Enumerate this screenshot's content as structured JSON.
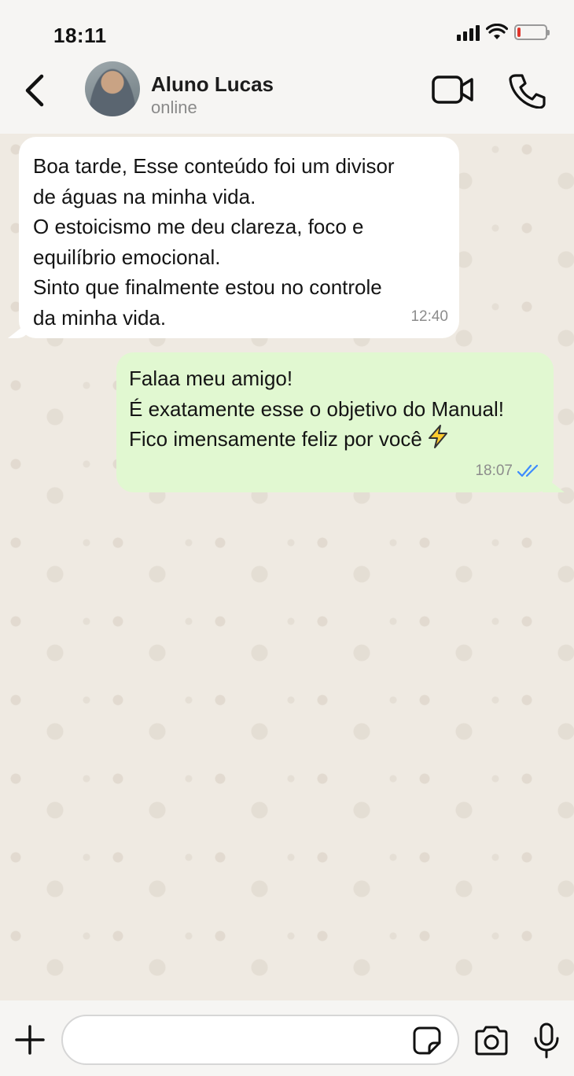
{
  "status_bar": {
    "time": "18:11",
    "battery_level": 0.12,
    "battery_color": "#e0352b"
  },
  "header": {
    "back_icon": "chevron-left-icon",
    "contact_name": "Aluno Lucas",
    "contact_status": "online",
    "video_icon": "video-camera-icon",
    "call_icon": "phone-icon"
  },
  "messages": [
    {
      "direction": "incoming",
      "lines": [
        "Boa tarde, Esse conteúdo foi um divisor",
        "de águas na minha vida.",
        "O estoicismo me deu clareza, foco e",
        "equilíbrio emocional.",
        "Sinto que finalmente estou no controle",
        "da minha vida."
      ],
      "time": "12:40"
    },
    {
      "direction": "outgoing",
      "lines": [
        "Falaa meu amigo!",
        "É exatamente esse o objetivo do Manual!",
        "Fico imensamente feliz por você"
      ],
      "emoji": "lightning-bolt-icon",
      "time": "18:07",
      "read_receipt": "double-check-icon",
      "read_color": "#3d8bfd"
    }
  ],
  "composer": {
    "placeholder": "",
    "plus_icon": "plus-icon",
    "sticker_icon": "sticker-icon",
    "camera_icon": "camera-icon",
    "mic_icon": "microphone-icon"
  },
  "colors": {
    "incoming_bubble": "#ffffff",
    "outgoing_bubble": "#e1f8d1",
    "chat_background": "#efeae2"
  }
}
